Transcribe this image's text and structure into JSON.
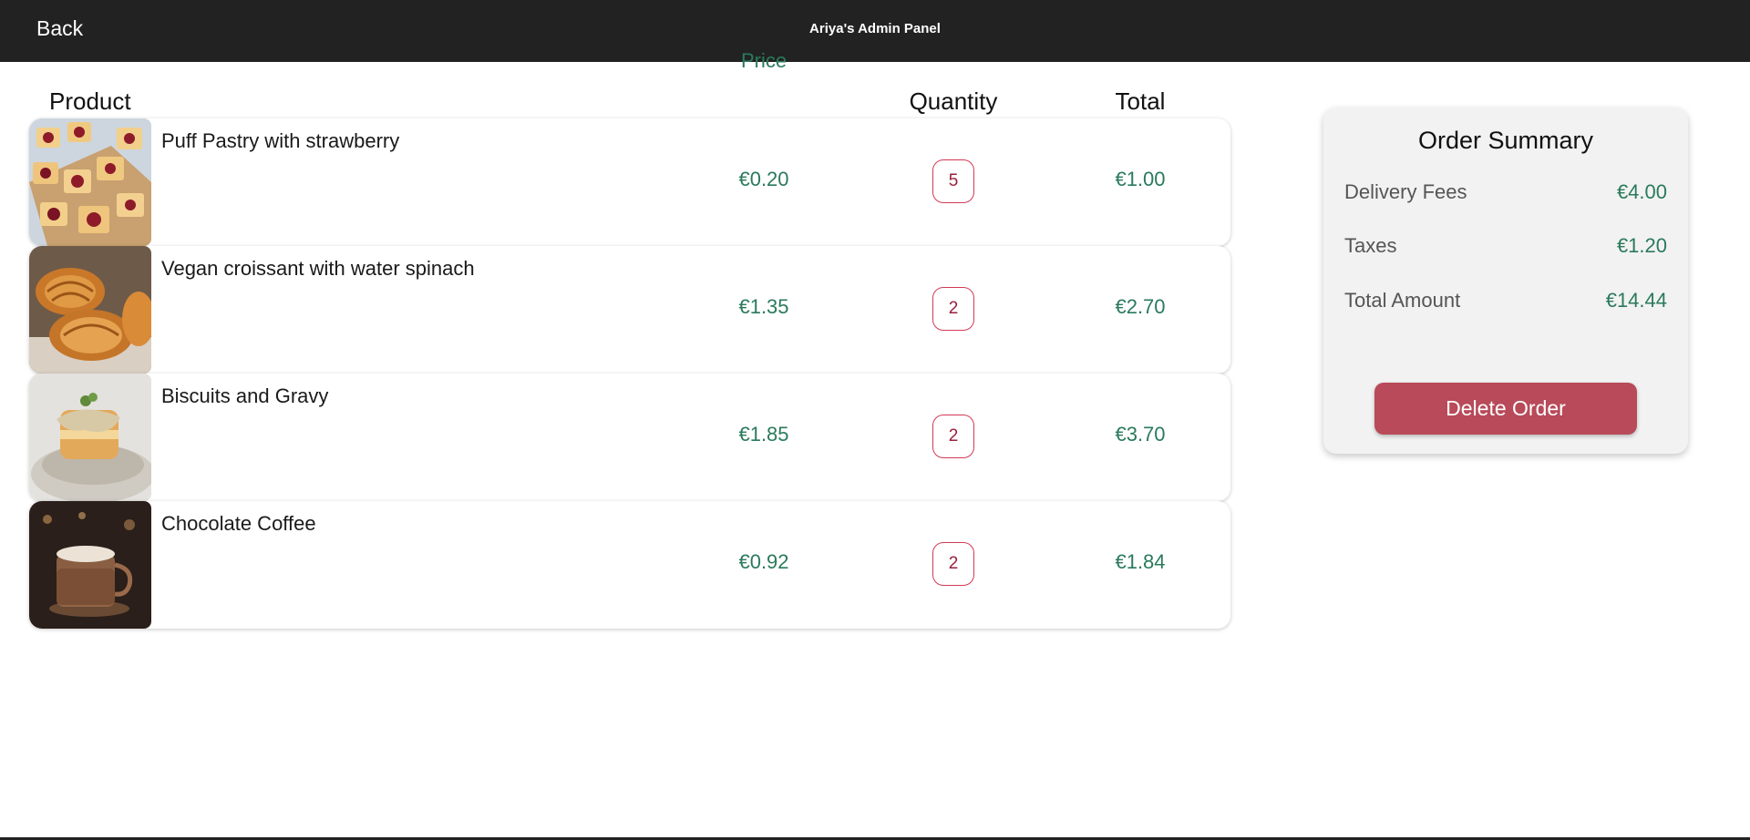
{
  "header": {
    "back_label": "Back",
    "title": "Ariya's Admin Panel"
  },
  "table": {
    "columns": {
      "product": "Product",
      "price": "Price",
      "quantity": "Quantity",
      "total": "Total"
    },
    "rows": [
      {
        "name": "Puff Pastry with strawberry",
        "price": "€0.20",
        "quantity": "5",
        "total": "€1.00"
      },
      {
        "name": "Vegan croissant with water spinach",
        "price": "€1.35",
        "quantity": "2",
        "total": "€2.70"
      },
      {
        "name": "Biscuits and Gravy",
        "price": "€1.85",
        "quantity": "2",
        "total": "€3.70"
      },
      {
        "name": "Chocolate Coffee",
        "price": "€0.92",
        "quantity": "2",
        "total": "€1.84"
      }
    ]
  },
  "summary": {
    "title": "Order Summary",
    "delivery_label": "Delivery Fees",
    "delivery_value": "€4.00",
    "taxes_label": "Taxes",
    "taxes_value": "€1.20",
    "total_label": "Total Amount",
    "total_value": "€14.44",
    "delete_label": "Delete Order"
  },
  "colors": {
    "topbar": "#222222",
    "price_green": "#2a7a5c",
    "qty_border": "#d23a55",
    "delete_button": "#b84a5a",
    "summary_bg": "#f2f2f2"
  }
}
